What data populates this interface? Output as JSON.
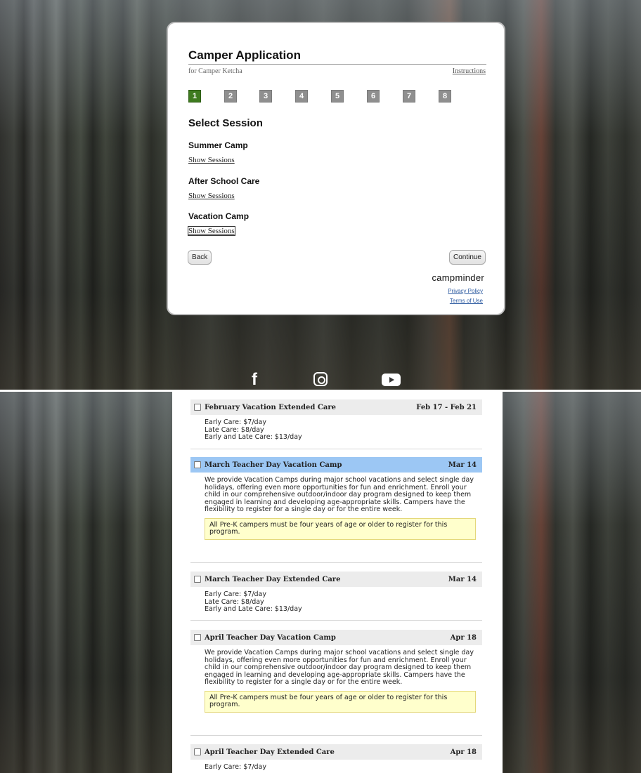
{
  "top": {
    "title": "Camper Application",
    "subtitle": "for Camper Ketcha",
    "instructions_link": "Instructions",
    "steps": [
      "1",
      "2",
      "3",
      "4",
      "5",
      "6",
      "7",
      "8"
    ],
    "active_step": "1",
    "section_title": "Select Session",
    "categories": [
      {
        "name": "Summer Camp",
        "link": "Show Sessions"
      },
      {
        "name": "After School Care",
        "link": "Show Sessions"
      },
      {
        "name": "Vacation Camp",
        "link": "Show Sessions"
      }
    ],
    "back_label": "Back",
    "continue_label": "Continue",
    "brand": "campminder",
    "privacy": "Privacy Policy",
    "terms": "Terms of Use"
  },
  "social": {
    "facebook": "f"
  },
  "sessions": [
    {
      "name": "February Vacation Extended Care",
      "dates": "Feb 17 - Feb 21",
      "lines": [
        "Early Care: $7/day",
        "Late Care: $8/day",
        "Early and Late Care: $13/day"
      ]
    },
    {
      "name": "March Teacher Day Vacation Camp",
      "dates": "Mar 14",
      "description": "We provide Vacation Camps during major school vacations and select single day holidays, offering even more opportunities for fun and enrichment. Enroll your child in our comprehensive outdoor/indoor day program designed to keep them engaged in learning and developing age-appropriate skills. Campers have the flexibility to register for a single day or for the entire week.",
      "note": "All Pre-K campers must be four years of age or older to register for this program."
    },
    {
      "name": "March Teacher Day Extended Care",
      "dates": "Mar 14",
      "lines": [
        "Early Care: $7/day",
        "Late Care: $8/day",
        "Early and Late Care: $13/day"
      ]
    },
    {
      "name": "April Teacher Day Vacation Camp",
      "dates": "Apr 18",
      "description": "We provide Vacation Camps during major school vacations and select single day holidays, offering even more opportunities for fun and enrichment. Enroll your child in our comprehensive outdoor/indoor day program designed to keep them engaged in learning and developing age-appropriate skills. Campers have the flexibility to register for a single day or for the entire week.",
      "note": "All Pre-K campers must be four years of age or older to register for this program."
    },
    {
      "name": "April Teacher Day Extended Care",
      "dates": "Apr 18",
      "lines": [
        "Early Care: $7/day"
      ]
    }
  ]
}
